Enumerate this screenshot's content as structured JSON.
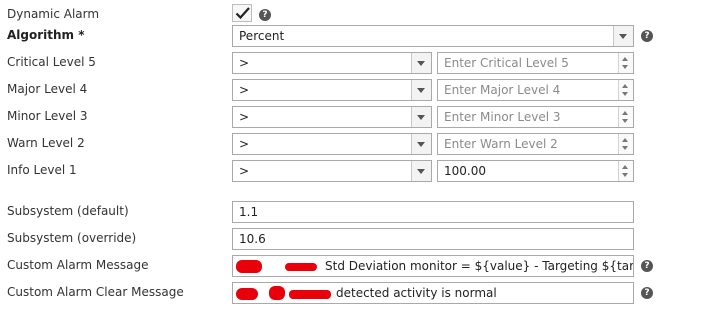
{
  "colors": {
    "redaction": "#e8000b",
    "border": "#a9a9a9"
  },
  "dynamic_alarm": {
    "label": "Dynamic Alarm",
    "checked": true,
    "icons": [
      "checkmark-icon",
      "help-icon"
    ]
  },
  "algorithm": {
    "label": "Algorithm *",
    "value": "Percent"
  },
  "levels": [
    {
      "label": "Critical Level 5",
      "operator": ">",
      "value": "",
      "placeholder": "Enter Critical Level 5"
    },
    {
      "label": "Major Level 4",
      "operator": ">",
      "value": "",
      "placeholder": "Enter Major Level 4"
    },
    {
      "label": "Minor Level 3",
      "operator": ">",
      "value": "",
      "placeholder": "Enter Minor Level 3"
    },
    {
      "label": "Warn Level 2",
      "operator": ">",
      "value": "",
      "placeholder": "Enter Warn Level 2"
    },
    {
      "label": "Info Level 1",
      "operator": ">",
      "value": "100.00",
      "placeholder": ""
    }
  ],
  "subsystem_default": {
    "label": "Subsystem (default)",
    "value": "1.1"
  },
  "subsystem_override": {
    "label": "Subsystem (override)",
    "value": "10.6"
  },
  "custom_alarm_message": {
    "label": "Custom Alarm Message",
    "value": "Std Deviation monitor = ${value} - Targeting ${target} has"
  },
  "custom_alarm_clear_message": {
    "label": "Custom Alarm Clear Message",
    "value": "detected activity is normal"
  },
  "help_glyph": "?"
}
